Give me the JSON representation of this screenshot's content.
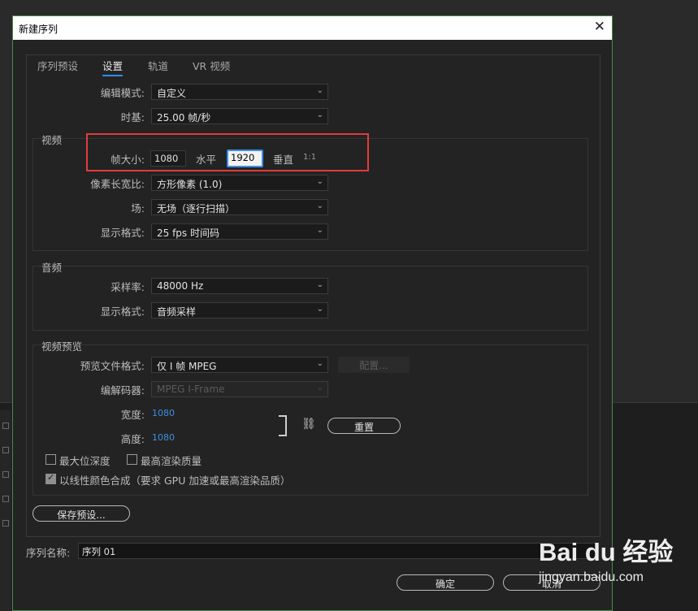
{
  "dialog": {
    "title": "新建序列",
    "close_glyph": "✕"
  },
  "tabs": [
    "序列预设",
    "设置",
    "轨道",
    "VR 视频"
  ],
  "settings": {
    "edit_mode": {
      "label": "编辑模式:",
      "value": "自定义"
    },
    "timebase": {
      "label": "时基:",
      "value": "25.00  帧/秒"
    }
  },
  "video": {
    "title": "视频",
    "frame_size_label": "帧大小:",
    "frame_width": "1080",
    "horizontal_label": "水平",
    "frame_height": "1920",
    "vertical_label": "垂直",
    "aspect": "1:1",
    "pixel_aspect": {
      "label": "像素长宽比:",
      "value": "方形像素 (1.0)"
    },
    "fields": {
      "label": "场:",
      "value": "无场（逐行扫描）"
    },
    "display_format": {
      "label": "显示格式:",
      "value": "25 fps 时间码"
    }
  },
  "audio": {
    "title": "音频",
    "sample_rate": {
      "label": "采样率:",
      "value": "48000 Hz"
    },
    "display_format": {
      "label": "显示格式:",
      "value": "音频采样"
    }
  },
  "preview": {
    "title": "视频预览",
    "file_format": {
      "label": "预览文件格式:",
      "value": "仅 I 帧 MPEG"
    },
    "configure_button": "配置...",
    "codec": {
      "label": "编解码器:",
      "value": "MPEG I-Frame"
    },
    "width": {
      "label": "宽度:",
      "value": "1080"
    },
    "height": {
      "label": "高度:",
      "value": "1080"
    },
    "reset_button": "重置"
  },
  "options": {
    "max_bit_depth": {
      "label": "最大位深度",
      "checked": false
    },
    "max_render_quality": {
      "label": "最高渲染质量",
      "checked": false
    },
    "linear_color": {
      "label": "以线性颜色合成（要求 GPU 加速或最高渲染品质）",
      "checked": true
    }
  },
  "save_preset_button": "保存预设...",
  "sequence_name": {
    "label": "序列名称:",
    "value": "序列 01"
  },
  "ok_button": "确定",
  "cancel_button": "取消",
  "watermark": {
    "brand": "Bai du 经验",
    "url": "jingyan.baidu.com"
  },
  "colors": {
    "accent": "#2d8ceb",
    "highlight_box": "#e03c3c",
    "value_blue": "#3d8fe0"
  }
}
